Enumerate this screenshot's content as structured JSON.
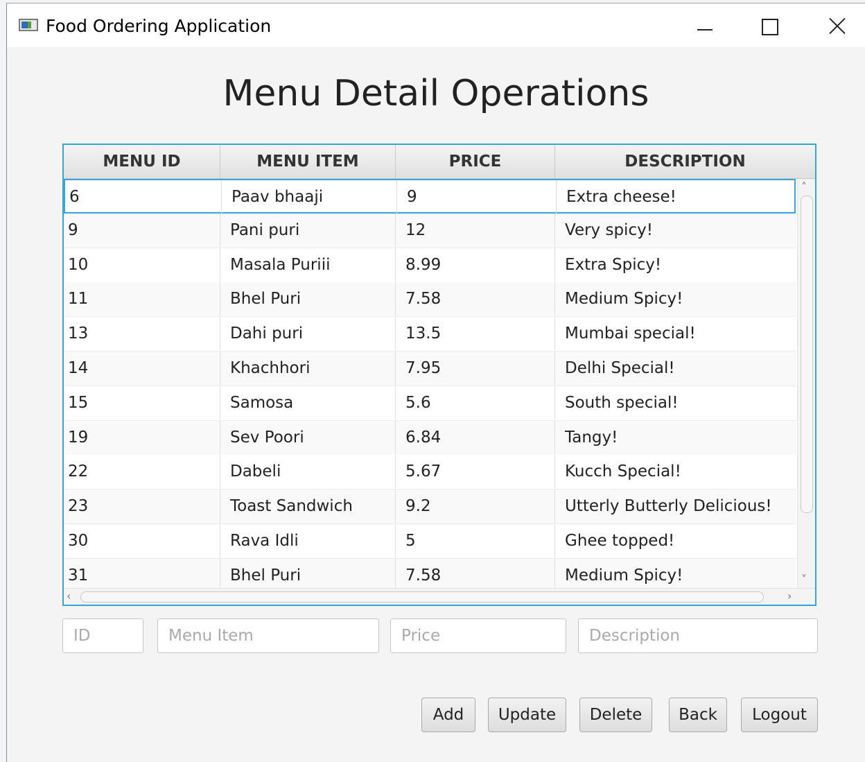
{
  "window": {
    "title": "Food Ordering Application"
  },
  "page": {
    "title": "Menu Detail Operations"
  },
  "table": {
    "columns": [
      "MENU ID",
      "MENU ITEM",
      "PRICE",
      "DESCRIPTION"
    ],
    "rows": [
      [
        "6",
        "Paav bhaaji",
        "9",
        "Extra cheese!"
      ],
      [
        "9",
        "Pani puri",
        "12",
        "Very spicy!"
      ],
      [
        "10",
        "Masala Puriii",
        "8.99",
        "Extra Spicy!"
      ],
      [
        "11",
        "Bhel Puri",
        "7.58",
        "Medium Spicy!"
      ],
      [
        "13",
        "Dahi puri",
        "13.5",
        "Mumbai special!"
      ],
      [
        "14",
        "Khachhori",
        "7.95",
        "Delhi Special!"
      ],
      [
        "15",
        "Samosa",
        "5.6",
        "South special!"
      ],
      [
        "19",
        "Sev Poori",
        "6.84",
        "Tangy!"
      ],
      [
        "22",
        "Dabeli",
        "5.67",
        "Kucch Special!"
      ],
      [
        "23",
        "Toast Sandwich",
        "9.2",
        "Utterly Butterly Delicious!"
      ],
      [
        "30",
        "Rava Idli",
        "5",
        "Ghee topped!"
      ],
      [
        "31",
        "Bhel Puri",
        "7.58",
        "Medium Spicy!"
      ]
    ]
  },
  "form": {
    "id_placeholder": "ID",
    "item_placeholder": "Menu Item",
    "price_placeholder": "Price",
    "description_placeholder": "Description"
  },
  "buttons": {
    "add": "Add",
    "update": "Update",
    "delete": "Delete",
    "back": "Back",
    "logout": "Logout"
  },
  "colors": {
    "accent": "#2ea8dc",
    "background": "#f4f4f4"
  }
}
